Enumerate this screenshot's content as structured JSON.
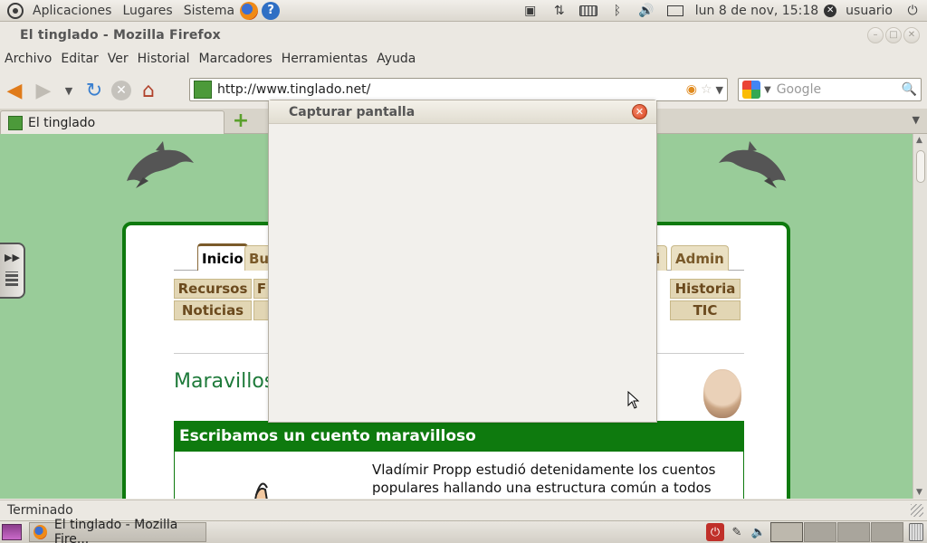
{
  "top_panel": {
    "menus": [
      "Aplicaciones",
      "Lugares",
      "Sistema"
    ],
    "clock": "lun  8 de nov, 15:18",
    "user": "usuario"
  },
  "window": {
    "title": "El tinglado - Mozilla Firefox"
  },
  "menubar": {
    "items": [
      "Archivo",
      "Editar",
      "Ver",
      "Historial",
      "Marcadores",
      "Herramientas",
      "Ayuda"
    ]
  },
  "navbar": {
    "url": "http://www.tinglado.net/",
    "search_placeholder": "Google"
  },
  "browser_tab": {
    "label": "El tinglado"
  },
  "page": {
    "tabs": [
      "Inicio",
      "Bus",
      "i",
      "Admin"
    ],
    "buttons_row1": [
      "Recursos",
      "F",
      "Historia"
    ],
    "buttons_row2": [
      "Noticias",
      "",
      "TIC"
    ],
    "heading": "Maravillos",
    "section_title": "Escribamos un cuento maravilloso",
    "article_text": "Vladímir Propp estudió detenidamente los cuentos populares hallando una estructura común a todos"
  },
  "statusbar": {
    "text": "Terminado"
  },
  "taskbar": {
    "task_label": "El tinglado - Mozilla Fire..."
  },
  "dialog": {
    "title": "Capturar pantalla"
  },
  "colors": {
    "page_background": "#99cc99",
    "content_border": "#0e7a0e",
    "heading_green": "#1e7a3a",
    "tab_button_bg": "#e2d6b4"
  }
}
